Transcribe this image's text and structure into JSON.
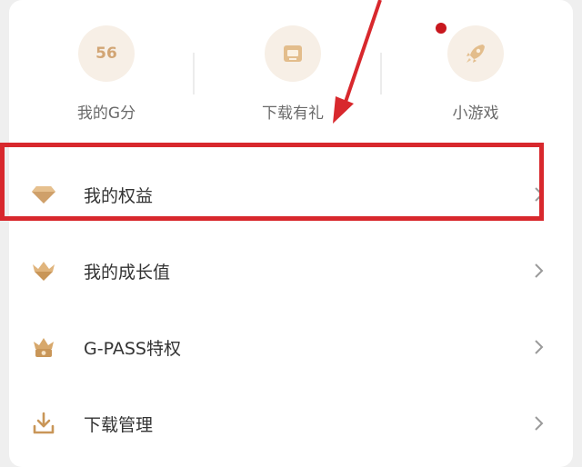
{
  "shortcuts": [
    {
      "label": "我的G分",
      "value": "56",
      "icon": "score-icon"
    },
    {
      "label": "下载有礼",
      "icon": "gift-box-icon"
    },
    {
      "label": "小游戏",
      "icon": "rocket-icon"
    }
  ],
  "menu": [
    {
      "label": "我的权益",
      "icon": "diamond-icon"
    },
    {
      "label": "我的成长值",
      "icon": "heart-crown-icon"
    },
    {
      "label": "G-PASS特权",
      "icon": "crown-badge-icon"
    },
    {
      "label": "下载管理",
      "icon": "download-icon"
    }
  ],
  "colors": {
    "accent_gold": "#d2a574",
    "highlight_red": "#d8282d",
    "notification_dot": "#c8171e"
  }
}
